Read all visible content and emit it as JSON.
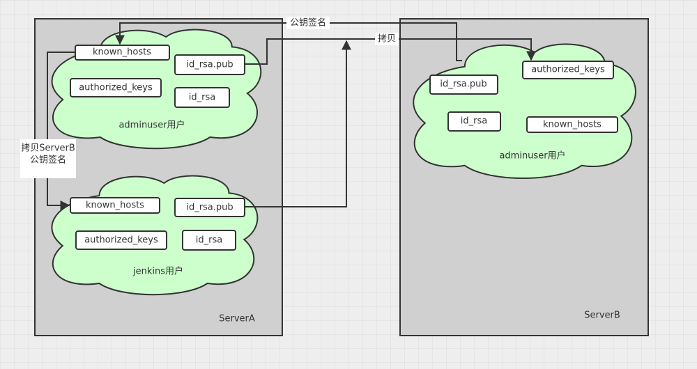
{
  "servers": {
    "a": {
      "name": "ServerA",
      "adminuser": {
        "label": "adminuser用户",
        "files": [
          "known_hosts",
          "id_rsa.pub",
          "authorized_keys",
          "id_rsa"
        ]
      },
      "jenkins": {
        "label": "jenkins用户",
        "files": [
          "known_hosts",
          "id_rsa.pub",
          "authorized_keys",
          "id_rsa"
        ]
      }
    },
    "b": {
      "name": "ServerB",
      "adminuser": {
        "label": "adminuser用户",
        "files": [
          "id_rsa.pub",
          "authorized_keys",
          "id_rsa",
          "known_hosts"
        ]
      }
    }
  },
  "edges": {
    "pubkey_sign": "公钥签名",
    "copy": "拷贝",
    "copy_serverb_line1": "拷贝ServerB",
    "copy_serverb_line2": "公钥签名"
  },
  "colors": {
    "server_fill": "#d0d0d0",
    "cloud_fill": "#ccffcc",
    "stroke": "#333333",
    "background": "#eeeeee"
  }
}
